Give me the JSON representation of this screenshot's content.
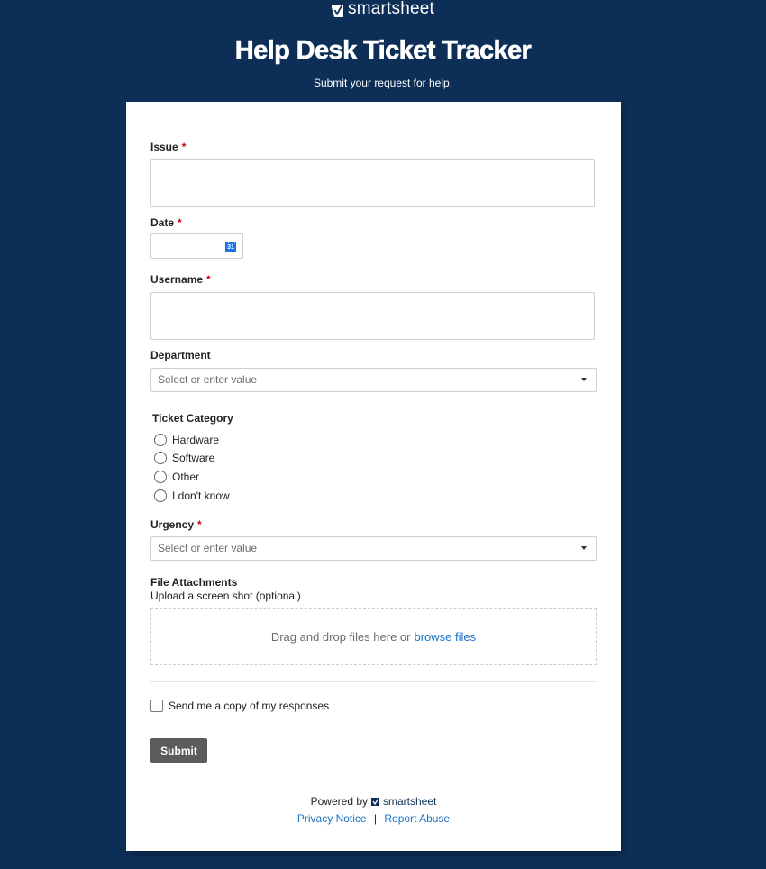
{
  "brand": {
    "name": "smartsheet",
    "logo_icon": "smartsheet-checkmark-logo-icon"
  },
  "header": {
    "title": "Help Desk Ticket Tracker",
    "subtitle": "Submit your request for help."
  },
  "colors": {
    "background": "#0d2f57",
    "required": "#d0021b",
    "link": "#1a73c8",
    "submit_button": "#5c5c5c",
    "calendar_icon": "#1a73e8"
  },
  "form": {
    "fields": {
      "issue": {
        "label": "Issue",
        "required_marker": "*",
        "value": ""
      },
      "date": {
        "label": "Date",
        "required_marker": "*",
        "value": "",
        "icon": "calendar-icon",
        "icon_text": "31"
      },
      "username": {
        "label": "Username",
        "required_marker": "*",
        "value": ""
      },
      "department": {
        "label": "Department",
        "placeholder": "Select or enter value"
      },
      "ticket_category": {
        "label": "Ticket Category",
        "options": [
          {
            "label": "Hardware",
            "selected": false
          },
          {
            "label": "Software",
            "selected": false
          },
          {
            "label": "Other",
            "selected": false
          },
          {
            "label": "I don't know",
            "selected": false
          }
        ]
      },
      "urgency": {
        "label": "Urgency",
        "required_marker": "*",
        "placeholder": "Select or enter value"
      },
      "file_attachments": {
        "label": "File Attachments",
        "helper": "Upload a screen shot (optional)",
        "dropzone_text": "Drag and drop files here or",
        "browse_label": "browse files"
      }
    },
    "send_copy": {
      "label": "Send me a copy of my responses",
      "checked": false
    },
    "submit_label": "Submit"
  },
  "footer": {
    "powered_by": "Powered by",
    "brand_name": "smartsheet",
    "privacy_label": "Privacy Notice",
    "separator": "|",
    "report_label": "Report Abuse"
  }
}
